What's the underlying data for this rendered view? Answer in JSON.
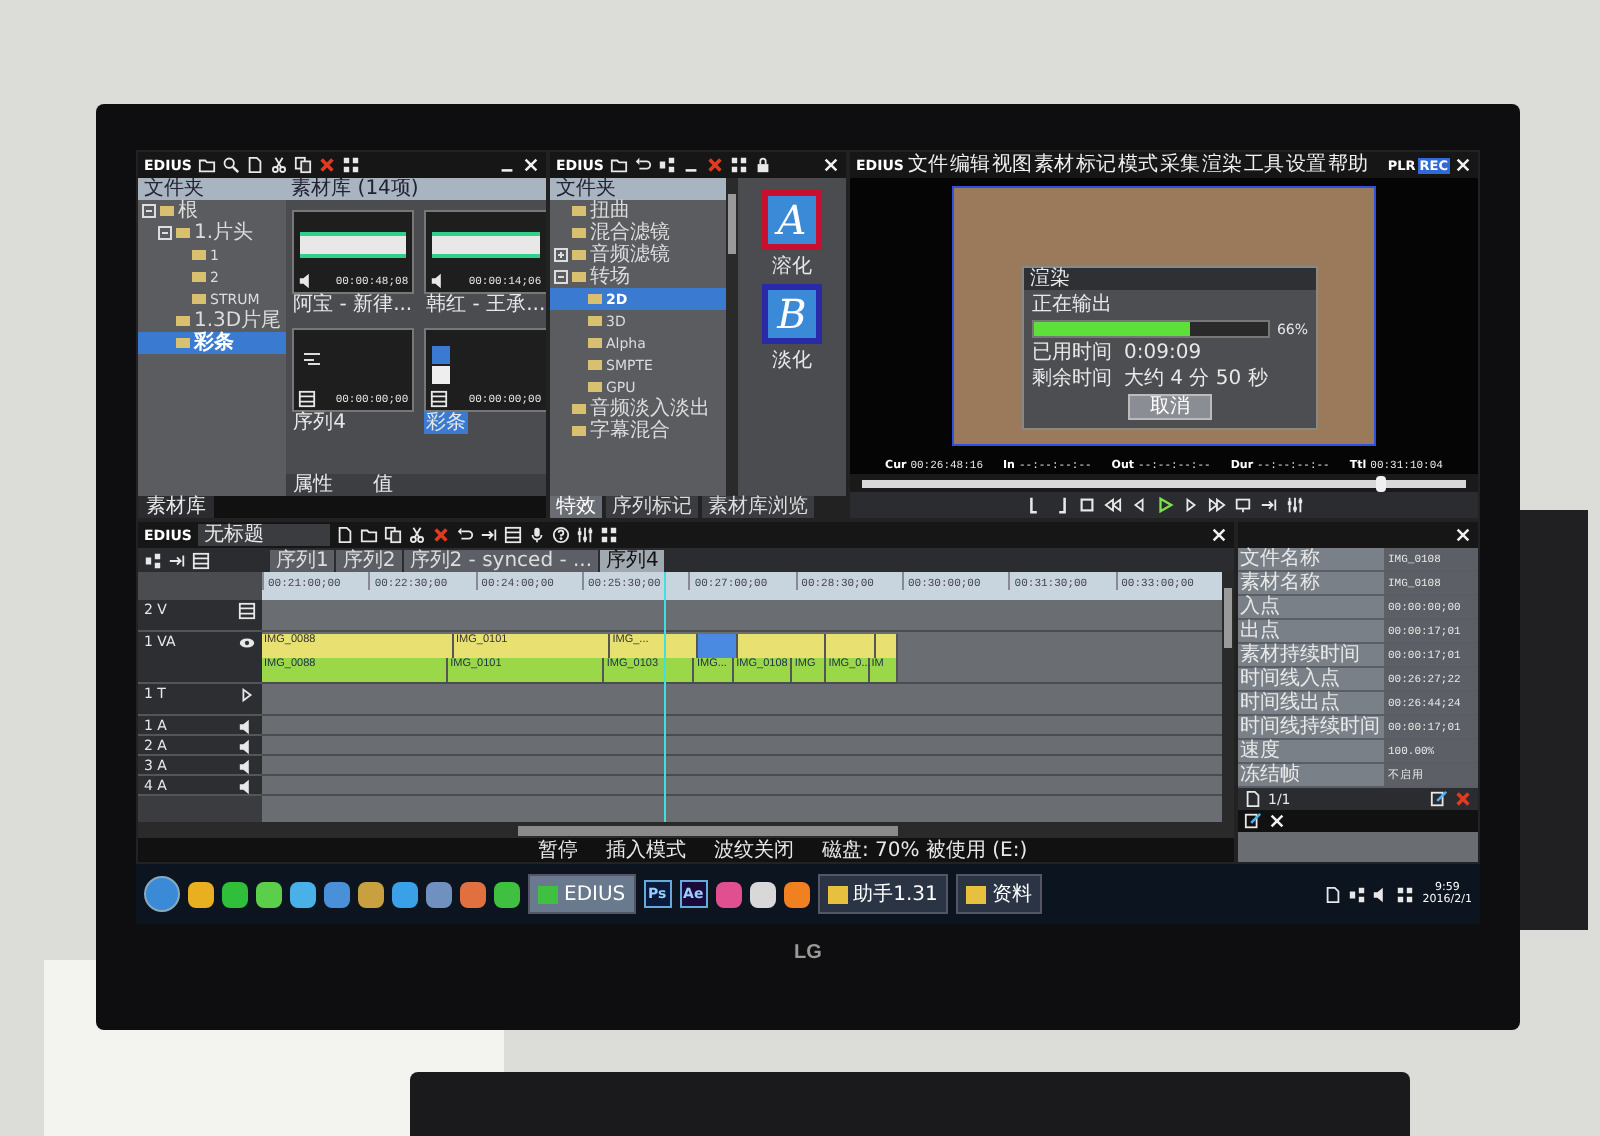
{
  "bin_window": {
    "logo": "EDIUS",
    "tree_header": "文件夹",
    "tree": [
      {
        "label": "根",
        "selected": false,
        "expanded": true,
        "children": [
          {
            "label": "1.片头",
            "selected": false,
            "expanded": true,
            "children": [
              {
                "label": "1",
                "selected": false
              },
              {
                "label": "2",
                "selected": false
              },
              {
                "label": "STRUM",
                "selected": false
              }
            ]
          },
          {
            "label": "1.3D片尾",
            "selected": false
          },
          {
            "label": "彩条",
            "selected": true
          }
        ]
      }
    ],
    "clips_header": "素材库 (14项)",
    "clips": [
      {
        "kind": "audio",
        "timecode": "00:00:48;08",
        "label": "阿宝 - 新律...",
        "selected": false
      },
      {
        "kind": "audio",
        "timecode": "00:00:14;06",
        "label": "韩红 - 王承...",
        "selected": false
      },
      {
        "kind": "sequence",
        "timecode": "00:00:00;00",
        "label": "序列4",
        "selected": false
      },
      {
        "kind": "color",
        "timecode": "00:00:00;00",
        "label": "彩条",
        "selected": true
      }
    ],
    "properties": [
      {
        "name": "属性",
        "value": "值"
      }
    ],
    "tab": "素材库"
  },
  "effects_window": {
    "logo": "EDIUS",
    "tree_header": "文件夹",
    "tree": [
      {
        "label": "扭曲",
        "selected": false
      },
      {
        "label": "混合滤镜",
        "selected": false
      },
      {
        "label": "音频滤镜",
        "selected": false,
        "expanded": false
      },
      {
        "label": "转场",
        "selected": false,
        "expanded": true,
        "children": [
          {
            "label": "2D",
            "selected": true
          },
          {
            "label": "3D",
            "selected": false
          },
          {
            "label": "Alpha",
            "selected": false
          },
          {
            "label": "SMPTE",
            "selected": false
          },
          {
            "label": "GPU",
            "selected": false
          }
        ]
      },
      {
        "label": "音频淡入淡出",
        "selected": false
      },
      {
        "label": "字幕混合",
        "selected": false
      }
    ],
    "previews": [
      {
        "glyph": "A",
        "label": "溶化",
        "color": "#c8102e"
      },
      {
        "glyph": "B",
        "label": "淡化",
        "color": "#2a2aa8"
      }
    ],
    "tabs": [
      {
        "label": "特效",
        "selected": true
      },
      {
        "label": "序列标记",
        "selected": false
      },
      {
        "label": "素材库浏览",
        "selected": false
      }
    ]
  },
  "player": {
    "logo": "EDIUS",
    "menu": [
      "文件",
      "编辑",
      "视图",
      "素材",
      "标记",
      "模式",
      "采集",
      "渲染",
      "工具",
      "设置",
      "帮助"
    ],
    "modes": [
      {
        "label": "PLR",
        "selected": false
      },
      {
        "label": "REC",
        "selected": true
      }
    ],
    "dialog": {
      "title": "渲染",
      "message": "正在输出",
      "level": 0.66,
      "percent": "66%",
      "rows": [
        {
          "label": "已用时间",
          "value": "0:09:09"
        },
        {
          "label": "剩余时间",
          "value": "大约 4 分 50 秒"
        }
      ],
      "button": "取消"
    },
    "timecodes": [
      {
        "label": "Cur",
        "value": "00:26:48:16"
      },
      {
        "label": "In",
        "value": "--:--:--:--"
      },
      {
        "label": "Out",
        "value": "--:--:--:--"
      },
      {
        "label": "Dur",
        "value": "--:--:--:--"
      },
      {
        "label": "Ttl",
        "value": "00:31:10:04"
      }
    ],
    "scrubber": {
      "level": 0.85
    }
  },
  "timeline": {
    "logo": "EDIUS",
    "sequence": "无标题",
    "tabs": [
      {
        "label": "序列1",
        "selected": false
      },
      {
        "label": "序列2",
        "selected": false
      },
      {
        "label": "序列2 - synced - ...",
        "selected": false
      },
      {
        "label": "序列4",
        "selected": true
      }
    ],
    "ruler": [
      "00:21:00;00",
      "00:22:30;00",
      "00:24:00;00",
      "00:25:30;00",
      "00:27:00;00",
      "00:28:30;00",
      "00:30:00;00",
      "00:31:30;00",
      "00:33:00;00"
    ],
    "tracks": [
      {
        "name": "2 V",
        "kind": "video"
      },
      {
        "name": "1 VA",
        "kind": "va",
        "video_clips": [
          {
            "name": "IMG_0088",
            "selected": false
          },
          {
            "name": "IMG_0101",
            "selected": false
          },
          {
            "name": "IMG_...",
            "selected": false
          },
          {
            "selected": true
          },
          {
            "selected": false
          },
          {
            "selected": false
          },
          {
            "selected": false
          }
        ],
        "audio_clips": [
          {
            "name": "IMG_0088",
            "selected": false
          },
          {
            "name": "IMG_0101",
            "selected": false
          },
          {
            "name": "IMG_0103",
            "selected": false
          },
          {
            "name": "IMG...",
            "selected": false
          },
          {
            "name": "IMG_0108",
            "selected": false
          },
          {
            "name": "IMG",
            "selected": false
          },
          {
            "name": "IMG_0...",
            "selected": false
          },
          {
            "name": "IM",
            "selected": false
          }
        ]
      },
      {
        "name": "1 T",
        "kind": "title"
      },
      {
        "name": "1 A",
        "kind": "audio"
      },
      {
        "name": "2 A",
        "kind": "audio"
      },
      {
        "name": "3 A",
        "kind": "audio"
      },
      {
        "name": "4 A",
        "kind": "audio"
      }
    ],
    "status": [
      "暂停",
      "插入模式",
      "波纹关闭",
      "磁盘: 70% 被使用 (E:)"
    ]
  },
  "info_panel": {
    "rows": [
      {
        "key": "文件名称",
        "value": "IMG_0108"
      },
      {
        "key": "素材名称",
        "value": "IMG_0108"
      },
      {
        "key": "入点",
        "value": "00:00:00;00"
      },
      {
        "key": "出点",
        "value": "00:00:17;01"
      },
      {
        "key": "素材持续时间",
        "value": "00:00:17;01"
      },
      {
        "key": "时间线入点",
        "value": "00:26:27;22"
      },
      {
        "key": "时间线出点",
        "value": "00:26:44;24"
      },
      {
        "key": "时间线持续时间",
        "value": "00:00:17;01"
      },
      {
        "key": "速度",
        "value": "100.00%"
      },
      {
        "key": "冻结帧",
        "value": "不启用"
      }
    ],
    "page": "1/1"
  },
  "taskbar": {
    "items": [
      {
        "kind": "start",
        "color": "#3a8ad8"
      },
      {
        "kind": "icon",
        "color": "#e8b020"
      },
      {
        "kind": "icon",
        "color": "#2fbf3a"
      },
      {
        "kind": "icon",
        "color": "#5ccf4a"
      },
      {
        "kind": "icon",
        "color": "#4ab0e8"
      },
      {
        "kind": "icon",
        "color": "#4a90d8"
      },
      {
        "kind": "icon",
        "color": "#c8a040"
      },
      {
        "kind": "icon",
        "color": "#3aa0e8"
      },
      {
        "kind": "icon",
        "color": "#7090c0"
      },
      {
        "kind": "icon",
        "color": "#e07040"
      },
      {
        "kind": "icon",
        "color": "#40c040"
      },
      {
        "kind": "window",
        "label": "EDIUS",
        "color": "#40c040",
        "selected": true
      },
      {
        "kind": "labeled",
        "label": "Ps",
        "color": "#0a1a3a"
      },
      {
        "kind": "labeled",
        "label": "Ae",
        "color": "#1a0a3a"
      },
      {
        "kind": "icon",
        "color": "#e05090"
      },
      {
        "kind": "icon",
        "color": "#d8d8d8"
      },
      {
        "kind": "icon",
        "color": "#f08020"
      },
      {
        "kind": "window",
        "label": "助手1.31",
        "color": "#e8c040",
        "selected": false
      },
      {
        "kind": "window",
        "label": "资料",
        "color": "#e8c040",
        "selected": false
      }
    ],
    "clock": "9:59",
    "date": "2016/2/1"
  },
  "monitor": {
    "brand": "LG"
  }
}
